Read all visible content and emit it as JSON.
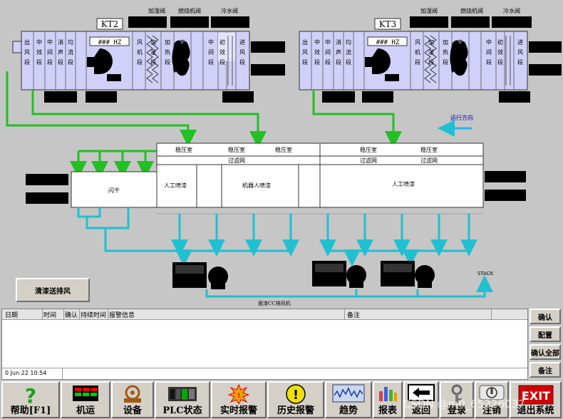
{
  "process": {
    "kt2_tag": "KT2",
    "kt3_tag": "KT3",
    "hz_display": "### HZ",
    "valve_mix": "加湿阀",
    "valve_burner": "燃烧机阀",
    "valve_cold": "冷水阀",
    "kt2_sections": [
      "出风段",
      "中效段",
      "中间段",
      "消声段",
      "均流段",
      "风机段",
      "加湿段",
      "加热段",
      "表冷段",
      "中间段",
      "初效段",
      "进风段"
    ],
    "kt3_sections": [
      "出风段",
      "中效段",
      "中间段",
      "消声段",
      "均流段",
      "风机段",
      "加湿段",
      "加热段",
      "表冷段",
      "中间段",
      "初效段",
      "进风段"
    ],
    "plenum_label": "稳压室",
    "filter_label": "过滤网",
    "flash_dry": "闪干",
    "manual_spray_1": "人工喷漆",
    "robot_spray": "机器人喷漆",
    "manual_spray_2": "人工喷漆",
    "run_direction": "运行方向",
    "stack": "STACK",
    "exhaust_fan": "面漆CC排风机",
    "clean_exhaust_button": "清漆送排风"
  },
  "alarm": {
    "columns": [
      "日期",
      "时间",
      "确认",
      "持续时间",
      "报警信息",
      "备注"
    ],
    "status_time": "0 Jun 22 10:54"
  },
  "side_buttons": [
    "确认",
    "配置",
    "确认全部",
    "备注"
  ],
  "nav": [
    {
      "label": "帮助[F1]",
      "icon": "help-icon"
    },
    {
      "label": "机运",
      "icon": "conveyor-icon"
    },
    {
      "label": "设备",
      "icon": "equipment-icon"
    },
    {
      "label": "PLC状态",
      "icon": "plc-icon"
    },
    {
      "label": "实时报警",
      "icon": "realtime-alarm-icon"
    },
    {
      "label": "历史报警",
      "icon": "history-alarm-icon"
    },
    {
      "label": "趋势",
      "icon": "trend-icon"
    },
    {
      "label": "报表",
      "icon": "report-icon"
    },
    {
      "label": "返回",
      "icon": "back-arrow-icon"
    },
    {
      "label": "登录",
      "icon": "login-key-icon"
    },
    {
      "label": "注销",
      "icon": "logout-icon"
    },
    {
      "label": "退出系统",
      "icon": "exit-icon",
      "icon_text": "EXIT"
    }
  ],
  "watermark": "CSDN @m0_65226037",
  "colors": {
    "background": "#c6c6c6",
    "ahu_fill": "#d0d0f8",
    "green_pipe": "#22c022",
    "cyan_pipe": "#20c0d0",
    "exit_red": "#d00000"
  }
}
